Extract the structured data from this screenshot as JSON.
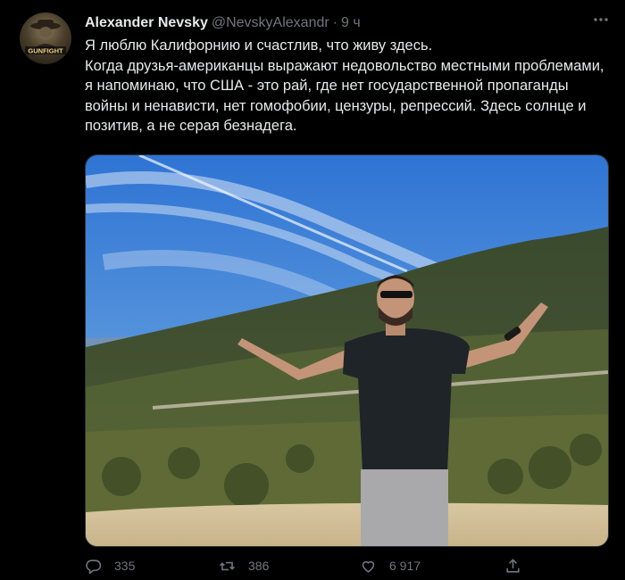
{
  "author": {
    "name": "Alexander Nevsky",
    "handle": "@NevskyAlexandr",
    "separator": "·",
    "time": "9 ч",
    "avatar_text": "GUNFIGHT"
  },
  "tweet": {
    "line1": "Я люблю Калифорнию и счастлив, что живу здесь.",
    "line2": "Когда друзья-американцы выражают недовольство местными проблемами, я напоминаю, что США - это рай, где нет государственной пропаганды войны и ненависти, нет гомофобии, цензуры, репрессий. Здесь солнце и позитив, а не серая безнадега."
  },
  "actions": {
    "replies": "335",
    "retweets": "386",
    "likes": "6 917"
  },
  "icons": {
    "more": "more-icon",
    "reply": "reply-icon",
    "retweet": "retweet-icon",
    "like": "heart-icon",
    "share": "share-icon"
  },
  "colors": {
    "background": "#000000",
    "text": "#e7e9ea",
    "secondary": "#71767b"
  }
}
